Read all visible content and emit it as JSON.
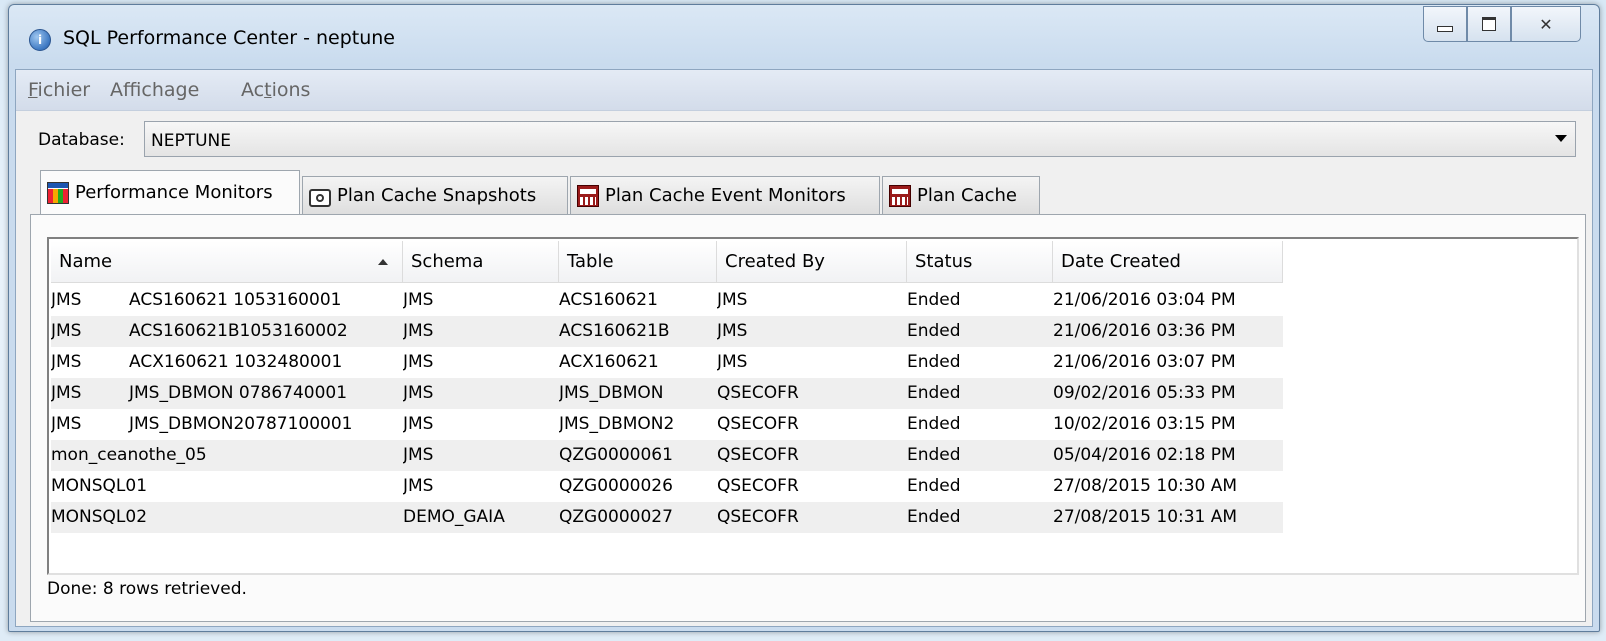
{
  "window": {
    "title": "SQL Performance Center - neptune",
    "app_icon": "info-icon"
  },
  "menubar": {
    "items": [
      {
        "label": "Fichier",
        "mnemonic": "F"
      },
      {
        "label": "Affichage",
        "mnemonic": "i"
      },
      {
        "label": "Actions",
        "mnemonic": "t"
      }
    ]
  },
  "database": {
    "label": "Database:",
    "value": "NEPTUNE"
  },
  "tabs": [
    {
      "label": "Performance Monitors",
      "icon": "performance-monitor-icon",
      "active": true
    },
    {
      "label": "Plan Cache Snapshots",
      "icon": "camera-icon"
    },
    {
      "label": "Plan Cache Event Monitors",
      "icon": "sql-monitor-icon"
    },
    {
      "label": "Plan Cache",
      "icon": "sql-icon"
    }
  ],
  "table": {
    "columns": [
      "Name",
      "Schema",
      "Table",
      "Created By",
      "Status",
      "Date Created"
    ],
    "sort_column": "Name",
    "rows": [
      {
        "name_a": "JMS",
        "name_b": "ACS160621 1053160001",
        "schema": "JMS",
        "table": "ACS160621",
        "created_by": "JMS",
        "status": "Ended",
        "date": "21/06/2016 03:04 PM"
      },
      {
        "name_a": "JMS",
        "name_b": "ACS160621B1053160002",
        "schema": "JMS",
        "table": "ACS160621B",
        "created_by": "JMS",
        "status": "Ended",
        "date": "21/06/2016 03:36 PM"
      },
      {
        "name_a": "JMS",
        "name_b": "ACX160621 1032480001",
        "schema": "JMS",
        "table": "ACX160621",
        "created_by": "JMS",
        "status": "Ended",
        "date": "21/06/2016 03:07 PM"
      },
      {
        "name_a": "JMS",
        "name_b": "JMS_DBMON 0786740001",
        "schema": "JMS",
        "table": "JMS_DBMON",
        "created_by": "QSECOFR",
        "status": "Ended",
        "date": "09/02/2016 05:33 PM"
      },
      {
        "name_a": "JMS",
        "name_b": "JMS_DBMON20787100001",
        "schema": "JMS",
        "table": "JMS_DBMON2",
        "created_by": "QSECOFR",
        "status": "Ended",
        "date": "10/02/2016 03:15 PM"
      },
      {
        "name_a": "mon_ceanothe_05",
        "name_b": "",
        "schema": "JMS",
        "table": "QZG0000061",
        "created_by": "QSECOFR",
        "status": "Ended",
        "date": "05/04/2016 02:18 PM"
      },
      {
        "name_a": "MONSQL01",
        "name_b": "",
        "schema": "JMS",
        "table": "QZG0000026",
        "created_by": "QSECOFR",
        "status": "Ended",
        "date": "27/08/2015 10:30 AM"
      },
      {
        "name_a": "MONSQL02",
        "name_b": "",
        "schema": "DEMO_GAIA",
        "table": "QZG0000027",
        "created_by": "QSECOFR",
        "status": "Ended",
        "date": "27/08/2015 10:31 AM"
      }
    ]
  },
  "status_text": "Done: 8 rows retrieved."
}
